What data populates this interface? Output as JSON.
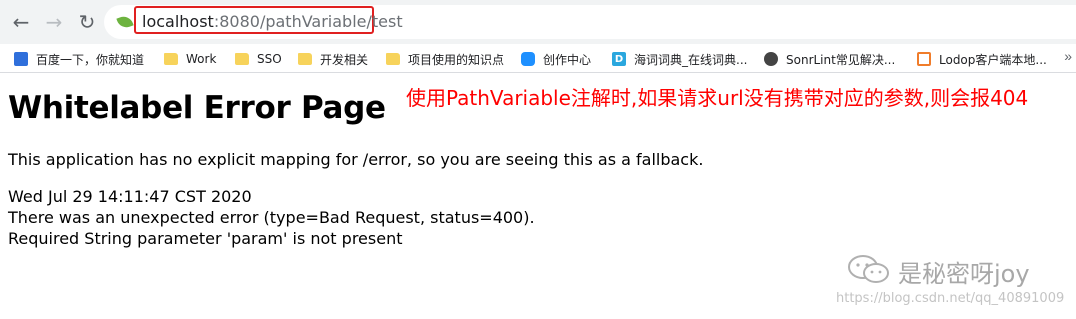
{
  "browser": {
    "nav": {
      "back_icon": "←",
      "forward_icon": "→",
      "reload_icon": "↻"
    },
    "address": {
      "host": "localhost",
      "path": ":8080/pathVariable/test"
    },
    "bookmarks": [
      {
        "label": "百度一下，你就知道",
        "icon": "baidu-icon"
      },
      {
        "label": "Work",
        "icon": "folder-icon"
      },
      {
        "label": "SSO",
        "icon": "folder-icon"
      },
      {
        "label": "开发相关",
        "icon": "folder-icon"
      },
      {
        "label": "项目使用的知识点",
        "icon": "folder-icon"
      },
      {
        "label": "创作中心",
        "icon": "creation-icon"
      },
      {
        "label": "海词词典_在线词典...",
        "icon": "haici-icon"
      },
      {
        "label": "SonrLint常见解决...",
        "icon": "sonarlint-icon"
      },
      {
        "label": "Lodop客户端本地...",
        "icon": "lodop-icon"
      }
    ],
    "more_icon": "»"
  },
  "page": {
    "title": "Whitelabel Error Page",
    "annotation": "使用PathVariable注解时,如果请求url没有携带对应的参数,则会报404",
    "message": "This application has no explicit mapping for /error, so you are seeing this as a fallback.",
    "timestamp": "Wed Jul 29 14:11:47 CST 2020",
    "error_line": "There was an unexpected error (type=Bad Request, status=400).",
    "detail": "Required String parameter 'param' is not present"
  },
  "watermark": {
    "name": "是秘密呀joy",
    "url": "https://blog.csdn.net/qq_40891009"
  },
  "colors": {
    "annotation": "#ff0000",
    "highlight_box": "#e02020"
  }
}
